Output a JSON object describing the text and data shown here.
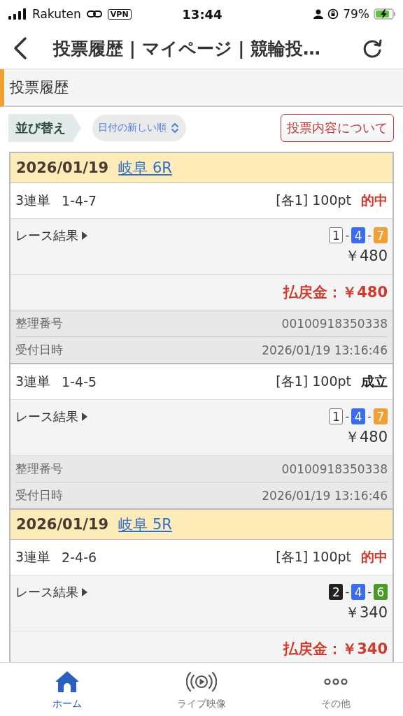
{
  "status_bar": {
    "carrier": "Rakuten",
    "vpn": "VPN",
    "time": "13:44",
    "battery": "79%"
  },
  "nav": {
    "title": "投票履歴 | マイページ | 競輪投…"
  },
  "section": {
    "title": "投票履歴"
  },
  "sort": {
    "label": "並び替え",
    "value": "日付の新しい順",
    "about_button": "投票内容について"
  },
  "groups": [
    {
      "date": "2026/01/19",
      "venue": "岐阜 6R",
      "bets": [
        {
          "type": "3連単",
          "numbers": "1-4-7",
          "stake": "[各1] 100pt",
          "status": "的中",
          "hit": true,
          "result_label": "レース結果",
          "result_separator": "-",
          "result_boxes": [
            {
              "number": "1",
              "color": "#ffffff"
            },
            {
              "number": "4",
              "color": "#3b6cf0"
            },
            {
              "number": "7",
              "color": "#f0a035"
            }
          ],
          "result_amount": "￥480",
          "payout": "払戻金：￥480",
          "serial_label": "整理番号",
          "serial": "00100918350338",
          "received_label": "受付日時",
          "received": "2026/01/19 13:16:46"
        },
        {
          "type": "3連単",
          "numbers": "1-4-5",
          "stake": "[各1] 100pt",
          "status": "成立",
          "hit": false,
          "result_label": "レース結果",
          "result_separator": "-",
          "result_boxes": [
            {
              "number": "1",
              "color": "#ffffff"
            },
            {
              "number": "4",
              "color": "#3b6cf0"
            },
            {
              "number": "7",
              "color": "#f0a035"
            }
          ],
          "result_amount": "￥480",
          "serial_label": "整理番号",
          "serial": "00100918350338",
          "received_label": "受付日時",
          "received": "2026/01/19 13:16:46"
        }
      ]
    },
    {
      "date": "2026/01/19",
      "venue": "岐阜 5R",
      "bets": [
        {
          "type": "3連単",
          "numbers": "2-4-6",
          "stake": "[各1] 100pt",
          "status": "的中",
          "hit": true,
          "result_label": "レース結果",
          "result_separator": "-",
          "result_boxes": [
            {
              "number": "2",
              "color": "#222222"
            },
            {
              "number": "4",
              "color": "#3b6cf0"
            },
            {
              "number": "6",
              "color": "#4a9a2a"
            }
          ],
          "result_amount": "￥340",
          "payout": "払戻金：￥340"
        }
      ]
    }
  ],
  "tab_bar": [
    {
      "label": "ホーム",
      "kind": "home",
      "selected": true
    },
    {
      "label": "ライブ映像",
      "kind": "live",
      "selected": false
    },
    {
      "label": "その他",
      "kind": "more",
      "selected": false
    }
  ]
}
